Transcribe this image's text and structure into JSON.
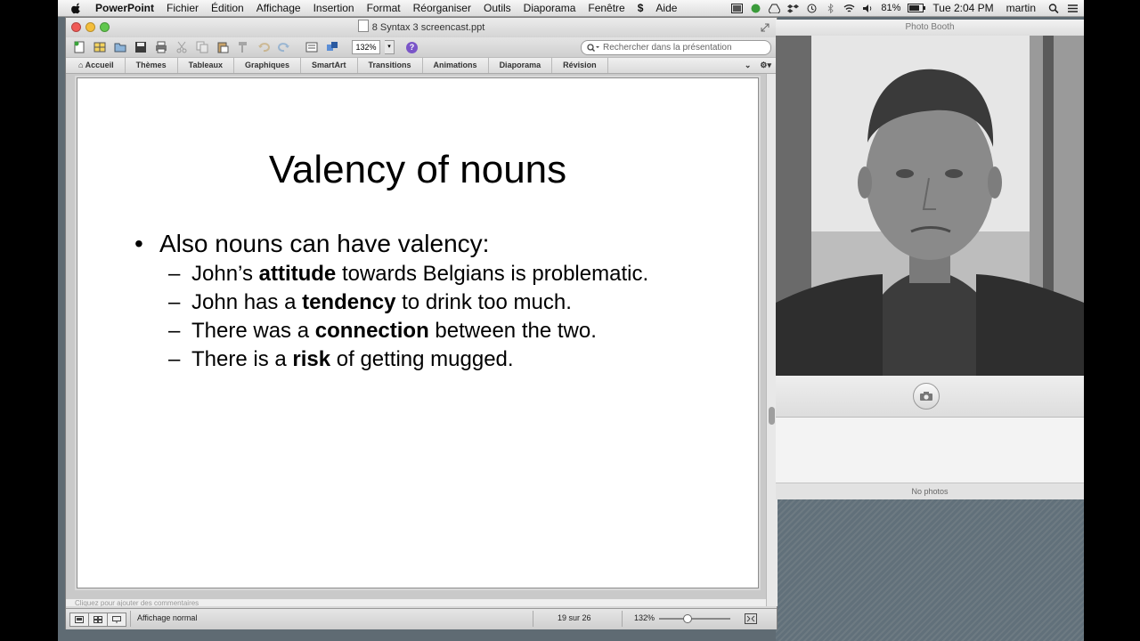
{
  "menubar": {
    "app_name": "PowerPoint",
    "items": [
      "Fichier",
      "Édition",
      "Affichage",
      "Insertion",
      "Format",
      "Réorganiser",
      "Outils",
      "Diaporama",
      "Fenêtre",
      "Aide"
    ],
    "battery": "81%",
    "clock": "Tue 2:04 PM",
    "user": "martin"
  },
  "ppt": {
    "window_title": "8 Syntax 3 screencast.ppt",
    "zoom_value": "132%",
    "help_glyph": "?",
    "search_placeholder": "Rechercher dans la présentation",
    "ribbon_tabs": [
      "Accueil",
      "Thèmes",
      "Tableaux",
      "Graphiques",
      "SmartArt",
      "Transitions",
      "Animations",
      "Diaporama",
      "Révision"
    ],
    "notes_placeholder": "Cliquez pour ajouter des commentaires",
    "status": {
      "view_name": "Affichage normal",
      "slide_position": "19 sur 26",
      "zoom": "132%"
    }
  },
  "slide": {
    "title": "Valency of nouns",
    "bullet": "Also nouns can have valency:",
    "subbullets": [
      {
        "pre": "John’s ",
        "bold": "attitude",
        "post": " towards Belgians is problematic."
      },
      {
        "pre": "John has a ",
        "bold": "tendency",
        "post": " to drink too much."
      },
      {
        "pre": "There was a ",
        "bold": "connection",
        "post": " between the two."
      },
      {
        "pre": "There is a ",
        "bold": "risk",
        "post": " of getting mugged."
      }
    ]
  },
  "photobooth": {
    "title": "Photo Booth",
    "empty_label": "No photos"
  },
  "colors": {
    "desktop": "#5f6b73",
    "help_accent": "#7a55c8"
  }
}
